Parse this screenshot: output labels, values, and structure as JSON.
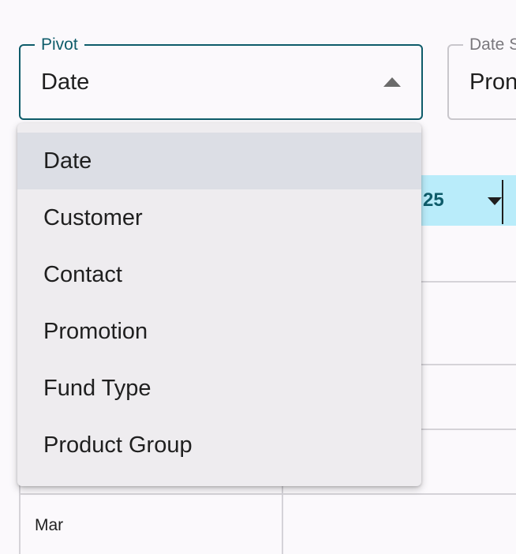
{
  "pivot": {
    "label": "Pivot",
    "value": "Date"
  },
  "date_select": {
    "label": "Date S",
    "value": "Pron"
  },
  "grid": {
    "header_text": "25",
    "row_label": "Mar"
  },
  "menu": {
    "items": [
      {
        "label": "Date",
        "selected": true
      },
      {
        "label": "Customer"
      },
      {
        "label": "Contact"
      },
      {
        "label": "Promotion"
      },
      {
        "label": "Fund Type"
      },
      {
        "label": "Product Group"
      }
    ]
  },
  "colors": {
    "accent": "#0e5c6a",
    "header_bg": "#b9ecfa",
    "menu_bg": "#eeecef",
    "selected_bg": "#dcdee5"
  }
}
